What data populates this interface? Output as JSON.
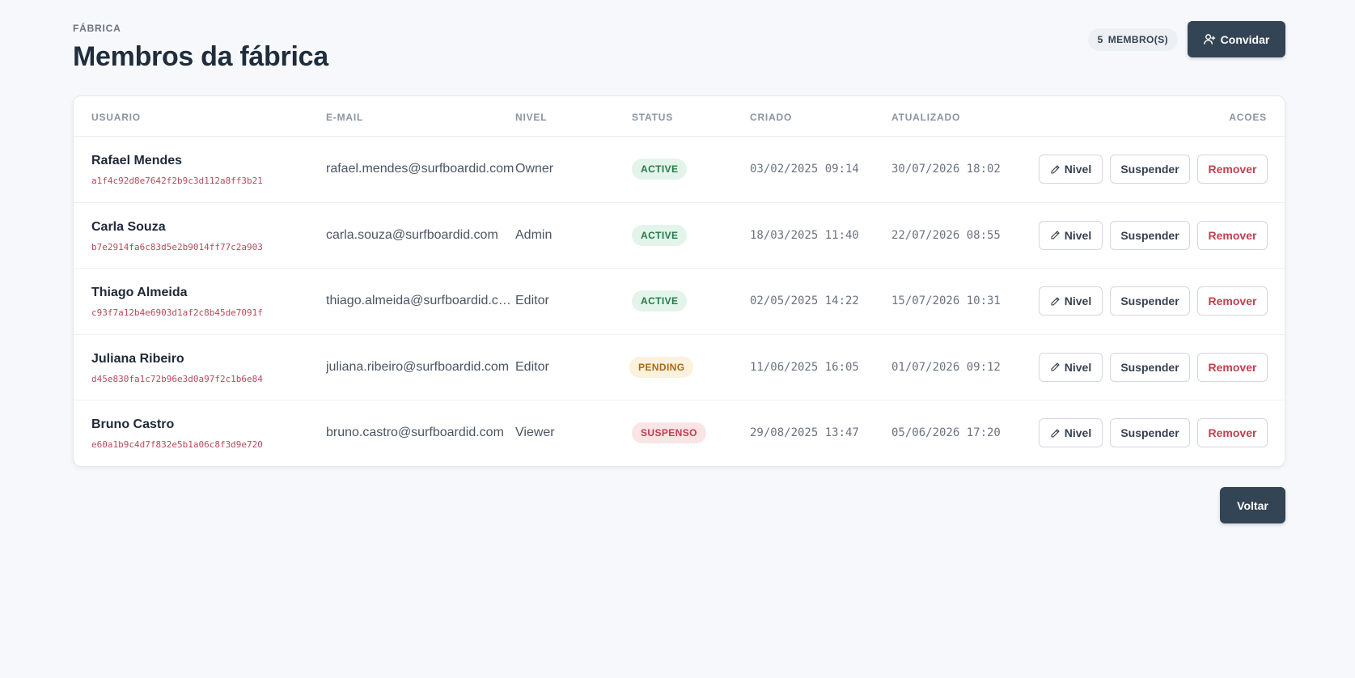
{
  "header": {
    "eyebrow": "FÁBRICA",
    "title": "Membros da fábrica",
    "member_count": "5",
    "member_count_label": "MEMBRO(S)",
    "invite_label": "Convidar"
  },
  "table": {
    "columns": [
      "USUARIO",
      "E-MAIL",
      "NIVEL",
      "STATUS",
      "CRIADO",
      "ATUALIZADO",
      "ACOES"
    ],
    "rows": [
      {
        "name": "Rafael Mendes",
        "id": "a1f4c92d8e7642f2b9c3d112a8ff3b21",
        "email": "rafael.mendes@surfboardid.com",
        "level": "Owner",
        "status": "ACTIVE",
        "status_type": "active",
        "created": "03/02/2025 09:14",
        "updated": "30/07/2026 18:02"
      },
      {
        "name": "Carla Souza",
        "id": "b7e2914fa6c83d5e2b9014ff77c2a903",
        "email": "carla.souza@surfboardid.com",
        "level": "Admin",
        "status": "ACTIVE",
        "status_type": "active",
        "created": "18/03/2025 11:40",
        "updated": "22/07/2026 08:55"
      },
      {
        "name": "Thiago Almeida",
        "id": "c93f7a12b4e6903d1af2c8b45de7091f",
        "email": "thiago.almeida@surfboardid.com",
        "level": "Editor",
        "status": "ACTIVE",
        "status_type": "active",
        "created": "02/05/2025 14:22",
        "updated": "15/07/2026 10:31"
      },
      {
        "name": "Juliana Ribeiro",
        "id": "d45e830fa1c72b96e3d0a97f2c1b6e84",
        "email": "juliana.ribeiro@surfboardid.com",
        "level": "Editor",
        "status": "PENDING",
        "status_type": "pending",
        "created": "11/06/2025 16:05",
        "updated": "01/07/2026 09:12"
      },
      {
        "name": "Bruno Castro",
        "id": "e60a1b9c4d7f832e5b1a06c8f3d9e720",
        "email": "bruno.castro@surfboardid.com",
        "level": "Viewer",
        "status": "SUSPENSO",
        "status_type": "suspended",
        "created": "29/08/2025 13:47",
        "updated": "05/06/2026 17:20"
      }
    ],
    "actions": {
      "level_label": "Nivel",
      "suspend_label": "Suspender",
      "remove_label": "Remover"
    }
  },
  "footer": {
    "back_label": "Voltar"
  },
  "icons": {
    "invite": "user-plus-icon",
    "level": "pencil-icon"
  },
  "colors": {
    "primary": "#334455",
    "active_bg": "#e3f4ea",
    "active_text": "#26784a",
    "pending_bg": "#fbf1dc",
    "pending_text": "#a86a12",
    "suspended_bg": "#fbe4e6",
    "suspended_text": "#c23b4c",
    "remove_text": "#c0414f"
  }
}
